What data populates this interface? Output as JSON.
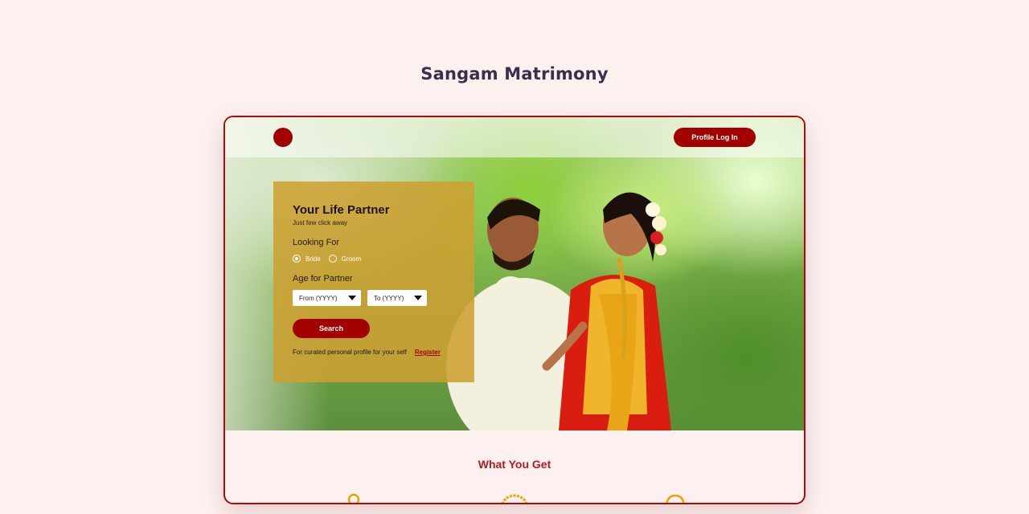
{
  "page": {
    "title": "Sangam Matrimony"
  },
  "header": {
    "login_label": "Profile Log In"
  },
  "search_card": {
    "title": "Your Life Partner",
    "subtitle": "Just few click away",
    "looking_for_label": "Looking For",
    "options": [
      "Bride",
      "Groom"
    ],
    "selected_option": "Bride",
    "age_label": "Age for Partner",
    "age_from_placeholder": "From (YYYY)",
    "age_to_placeholder": "To (YYYY)",
    "search_label": "Search",
    "register_prompt": "For curated personal profile for your self",
    "register_label": "Register"
  },
  "features": {
    "title": "What You Get",
    "icons": [
      "person-icon",
      "badge-icon",
      "ring-icon"
    ]
  },
  "colors": {
    "brand": "#a30000",
    "card": "#cda032",
    "background": "#fdf1f0",
    "title": "#3a2e4f"
  }
}
